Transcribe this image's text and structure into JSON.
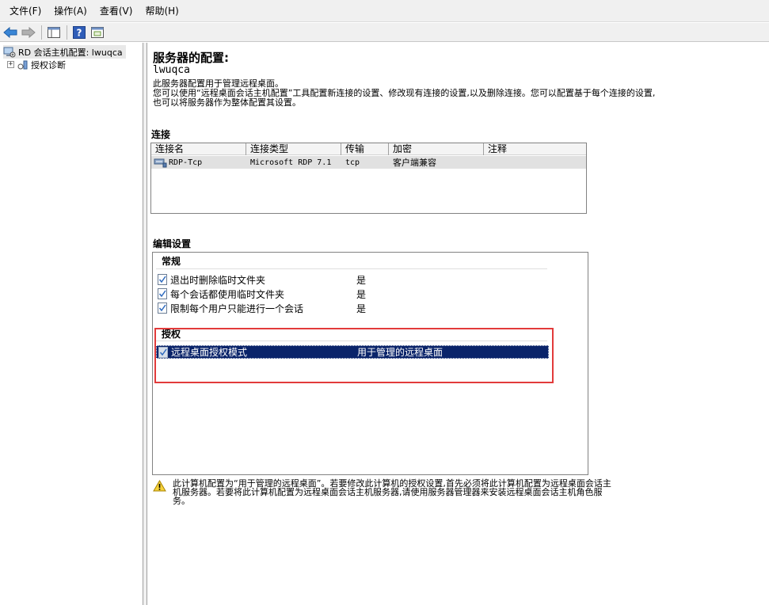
{
  "menu": {
    "items": [
      "文件(F)",
      "操作(A)",
      "查看(V)",
      "帮助(H)"
    ]
  },
  "toolbar": {
    "buttons": [
      "back-arrow-icon",
      "forward-arrow-icon",
      "console-tree-icon",
      "help-icon",
      "action-pane-icon"
    ]
  },
  "tree": {
    "root_label": "RD 会话主机配置: lwuqca",
    "child_label": "授权诊断",
    "expander": "+"
  },
  "main": {
    "title": "服务器的配置:",
    "server_name": "lwuqca",
    "description_line1": "此服务器配置用于管理远程桌面。",
    "description_line2": "您可以使用“远程桌面会话主机配置”工具配置新连接的设置、修改现有连接的设置,以及删除连接。您可以配置基于每个连接的设置,也可以将服务器作为整体配置其设置。"
  },
  "connections": {
    "section_label": "连接",
    "columns": [
      "连接名",
      "连接类型",
      "传输",
      "加密",
      "注释"
    ],
    "rows": [
      {
        "name": "RDP-Tcp",
        "type": "Microsoft RDP 7.1",
        "transport": "tcp",
        "encryption": "客户端兼容",
        "comment": ""
      }
    ]
  },
  "settings": {
    "section_label": "编辑设置",
    "general": {
      "title": "常规",
      "items": [
        {
          "label": "退出时删除临时文件夹",
          "value": "是"
        },
        {
          "label": "每个会话都使用临时文件夹",
          "value": "是"
        },
        {
          "label": "限制每个用户只能进行一个会话",
          "value": "是"
        }
      ]
    },
    "licensing": {
      "title": "授权",
      "items": [
        {
          "label": "远程桌面授权模式",
          "value": "用于管理的远程桌面"
        }
      ]
    }
  },
  "warning": {
    "text": "此计算机配置为“用于管理的远程桌面”。若要修改此计算机的授权设置,首先必须将此计算机配置为远程桌面会话主机服务器。若要将此计算机配置为远程桌面会话主机服务器,请使用服务器管理器来安装远程桌面会话主机角色服务。"
  },
  "colors": {
    "selection": "#0a246a",
    "highlight_box": "#e23b3b",
    "chrome": "#f0f0f0"
  }
}
